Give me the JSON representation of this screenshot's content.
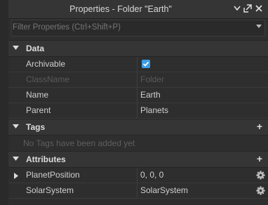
{
  "window": {
    "title": "Properties - Folder \"Earth\""
  },
  "filter": {
    "placeholder": "Filter Properties (Ctrl+Shift+P)"
  },
  "sections": {
    "data": {
      "label": "Data"
    },
    "tags": {
      "label": "Tags",
      "empty_text": "No Tags have been added yet"
    },
    "attributes": {
      "label": "Attributes"
    }
  },
  "data_rows": {
    "archivable": {
      "name": "Archivable",
      "checked": true
    },
    "classname": {
      "name": "ClassName",
      "value": "Folder"
    },
    "name": {
      "name": "Name",
      "value": "Earth"
    },
    "parent": {
      "name": "Parent",
      "value": "Planets"
    }
  },
  "attribute_rows": {
    "planet_position": {
      "name": "PlanetPosition",
      "value": "0, 0, 0"
    },
    "solar_system": {
      "name": "SolarSystem",
      "value": "SolarSystem"
    }
  },
  "colors": {
    "accent": "#3b9de7",
    "background": "#2e2e2e",
    "header": "#353535"
  },
  "icons": {
    "close": "close-icon",
    "popout": "popout-icon",
    "menu": "menu-icon",
    "gear": "gear-icon"
  }
}
